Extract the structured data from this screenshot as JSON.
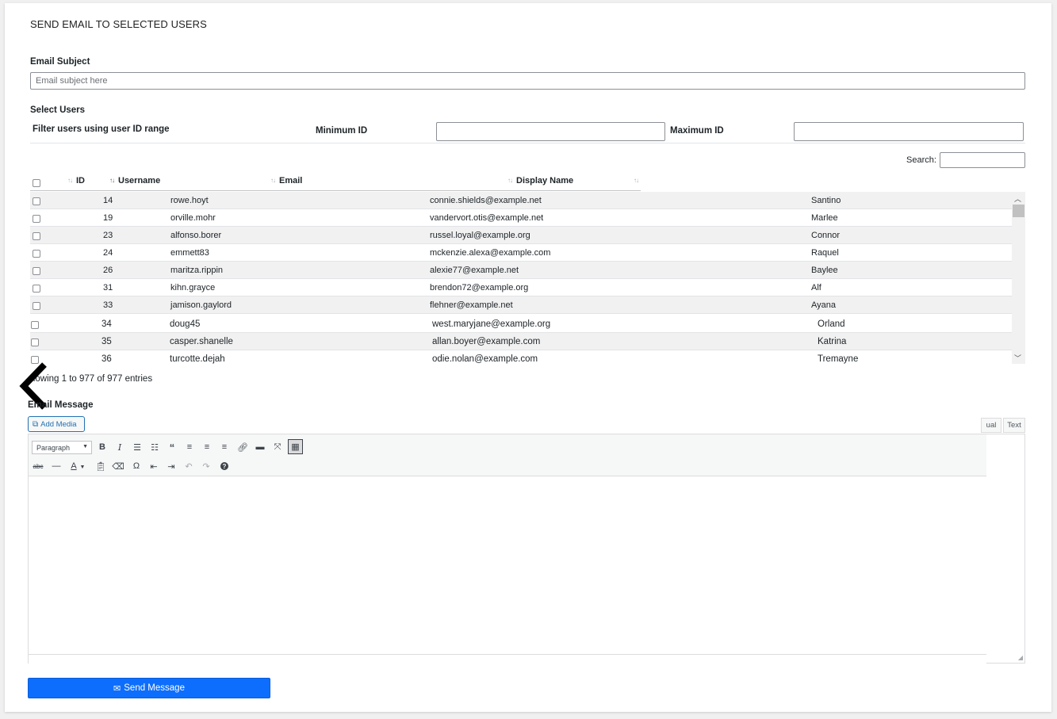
{
  "page": {
    "title": "SEND EMAIL TO SELECTED USERS"
  },
  "subject": {
    "label": "Email Subject",
    "placeholder": "Email subject here"
  },
  "select_users": {
    "label": "Select Users",
    "filter_label": "Filter users using user ID range",
    "min_label": "Minimum ID",
    "max_label": "Maximum ID"
  },
  "search": {
    "label": "Search:"
  },
  "table": {
    "columns": [
      "ID",
      "Username",
      "Email",
      "Display Name"
    ],
    "rows": [
      {
        "id": "14",
        "username": "rowe.hoyt",
        "email": "connie.shields@example.net",
        "display": "Santino"
      },
      {
        "id": "19",
        "username": "orville.mohr",
        "email": "vandervort.otis@example.net",
        "display": "Marlee"
      },
      {
        "id": "23",
        "username": "alfonso.borer",
        "email": "russel.loyal@example.org",
        "display": "Connor"
      },
      {
        "id": "24",
        "username": "emmett83",
        "email": "mckenzie.alexa@example.com",
        "display": "Raquel"
      },
      {
        "id": "26",
        "username": "maritza.rippin",
        "email": "alexie77@example.net",
        "display": "Baylee"
      },
      {
        "id": "31",
        "username": "kihn.grayce",
        "email": "brendon72@example.org",
        "display": "Alf"
      },
      {
        "id": "33",
        "username": "jamison.gaylord",
        "email": "flehner@example.net",
        "display": "Ayana"
      },
      {
        "id": "34",
        "username": "doug45",
        "email": "west.maryjane@example.org",
        "display": "Orland"
      },
      {
        "id": "35",
        "username": "casper.shanelle",
        "email": "allan.boyer@example.com",
        "display": "Katrina"
      },
      {
        "id": "36",
        "username": "turcotte.dejah",
        "email": "odie.nolan@example.com",
        "display": "Tremayne"
      }
    ],
    "info": "howing 1 to 977 of 977 entries"
  },
  "message": {
    "label": "Email Message",
    "add_media": "Add Media",
    "tab_visual": "ual",
    "tab_text": "Text",
    "format_select": "Paragraph"
  },
  "toolbar_icons": {
    "row1": [
      "bold-icon",
      "italic-icon",
      "bullet-list-icon",
      "numbered-list-icon",
      "blockquote-icon",
      "align-left-icon",
      "align-center-icon",
      "align-right-icon",
      "link-icon",
      "read-more-icon",
      "fullscreen-icon",
      "toolbar-toggle-icon"
    ],
    "row2": [
      "strikethrough-icon",
      "horizontal-line-icon",
      "text-color-icon",
      "paste-text-icon",
      "clear-formatting-icon",
      "special-character-icon",
      "outdent-icon",
      "indent-icon",
      "undo-icon",
      "redo-icon",
      "help-icon"
    ]
  },
  "send": {
    "label": "Send Message"
  },
  "colors": {
    "primary": "#0d6efd",
    "wp_blue": "#2271b1"
  }
}
